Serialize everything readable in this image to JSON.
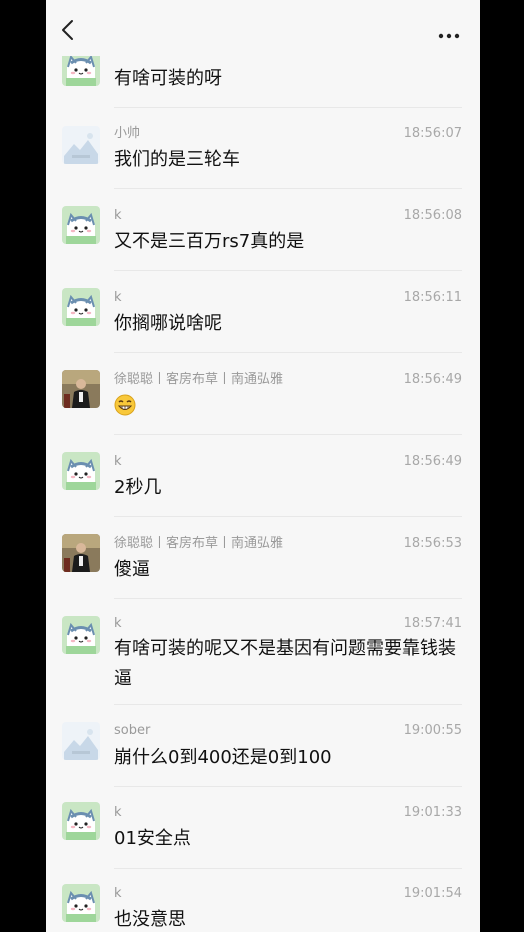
{
  "header": {
    "back_icon": "chevron-left-icon",
    "more_icon": "more-dots-icon"
  },
  "messages": [
    {
      "sender": "",
      "time": "",
      "text": "有啥可装的呀",
      "avatar": "cat-avatar"
    },
    {
      "sender": "小帅",
      "time": "18:56:07",
      "text": "我们的是三轮车",
      "avatar": "placeholder-avatar"
    },
    {
      "sender": "k",
      "time": "18:56:08",
      "text": "又不是三百万rs7真的是",
      "avatar": "cat-avatar"
    },
    {
      "sender": "k",
      "time": "18:56:11",
      "text": "你搁哪说啥呢",
      "avatar": "cat-avatar"
    },
    {
      "sender": "徐聪聪丨客房布草丨南通弘雅",
      "time": "18:56:49",
      "text": "",
      "emoji": "grin-emoji",
      "avatar": "photo-avatar"
    },
    {
      "sender": "k",
      "time": "18:56:49",
      "text": "2秒几",
      "avatar": "cat-avatar"
    },
    {
      "sender": "徐聪聪丨客房布草丨南通弘雅",
      "time": "18:56:53",
      "text": "傻逼",
      "avatar": "photo-avatar"
    },
    {
      "sender": "k",
      "time": "18:57:41",
      "text": "有啥可装的呢又不是基因有问题需要靠钱装逼",
      "avatar": "cat-avatar"
    },
    {
      "sender": "sober",
      "time": "19:00:55",
      "text": "崩什么0到400还是0到100",
      "avatar": "placeholder-avatar"
    },
    {
      "sender": "k",
      "time": "19:01:33",
      "text": "01安全点",
      "avatar": "cat-avatar"
    },
    {
      "sender": "k",
      "time": "19:01:54",
      "text": "也没意思",
      "avatar": "cat-avatar"
    }
  ]
}
